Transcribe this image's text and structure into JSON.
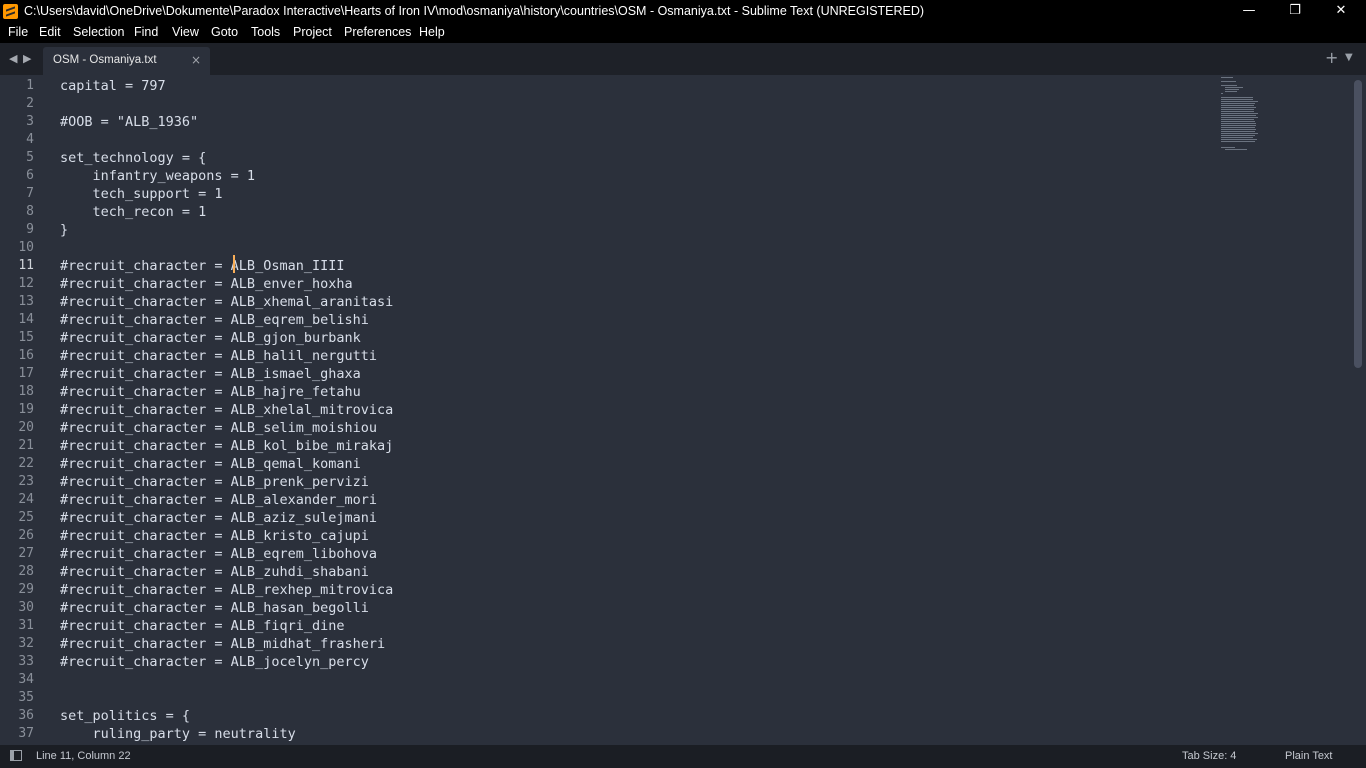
{
  "window": {
    "title": "C:\\Users\\david\\OneDrive\\Dokumente\\Paradox Interactive\\Hearts of Iron IV\\mod\\osmaniya\\history\\countries\\OSM - Osmaniya.txt - Sublime Text (UNREGISTERED)",
    "minimize_glyph": "—",
    "restore_glyph": "❐",
    "close_glyph": "✕"
  },
  "menu": [
    "File",
    "Edit",
    "Selection",
    "Find",
    "View",
    "Goto",
    "Tools",
    "Project",
    "Preferences",
    "Help"
  ],
  "tabs": {
    "active_label": "OSM - Osmaniya.txt",
    "close_glyph": "×",
    "back_glyph": "◀",
    "forward_glyph": "▶",
    "plus_glyph": "+",
    "menu_glyph": "▼"
  },
  "editor": {
    "active_line": 11,
    "lines": [
      {
        "n": "1",
        "text": "capital = 797"
      },
      {
        "n": "2",
        "text": ""
      },
      {
        "n": "3",
        "text": "#OOB = \"ALB_1936\""
      },
      {
        "n": "4",
        "text": ""
      },
      {
        "n": "5",
        "text": "set_technology = {"
      },
      {
        "n": "6",
        "text": "    infantry_weapons = 1"
      },
      {
        "n": "7",
        "text": "    tech_support = 1"
      },
      {
        "n": "8",
        "text": "    tech_recon = 1"
      },
      {
        "n": "9",
        "text": "}"
      },
      {
        "n": "10",
        "text": ""
      },
      {
        "n": "11",
        "text": "#recruit_character = ALB_Osman_IIII"
      },
      {
        "n": "12",
        "text": "#recruit_character = ALB_enver_hoxha"
      },
      {
        "n": "13",
        "text": "#recruit_character = ALB_xhemal_aranitasi"
      },
      {
        "n": "14",
        "text": "#recruit_character = ALB_eqrem_belishi"
      },
      {
        "n": "15",
        "text": "#recruit_character = ALB_gjon_burbank"
      },
      {
        "n": "16",
        "text": "#recruit_character = ALB_halil_nergutti"
      },
      {
        "n": "17",
        "text": "#recruit_character = ALB_ismael_ghaxa"
      },
      {
        "n": "18",
        "text": "#recruit_character = ALB_hajre_fetahu"
      },
      {
        "n": "19",
        "text": "#recruit_character = ALB_xhelal_mitrovica"
      },
      {
        "n": "20",
        "text": "#recruit_character = ALB_selim_moishiou"
      },
      {
        "n": "21",
        "text": "#recruit_character = ALB_kol_bibe_mirakaj"
      },
      {
        "n": "22",
        "text": "#recruit_character = ALB_qemal_komani"
      },
      {
        "n": "23",
        "text": "#recruit_character = ALB_prenk_pervizi"
      },
      {
        "n": "24",
        "text": "#recruit_character = ALB_alexander_mori"
      },
      {
        "n": "25",
        "text": "#recruit_character = ALB_aziz_sulejmani"
      },
      {
        "n": "26",
        "text": "#recruit_character = ALB_kristo_cajupi"
      },
      {
        "n": "27",
        "text": "#recruit_character = ALB_eqrem_libohova"
      },
      {
        "n": "28",
        "text": "#recruit_character = ALB_zuhdi_shabani"
      },
      {
        "n": "29",
        "text": "#recruit_character = ALB_rexhep_mitrovica"
      },
      {
        "n": "30",
        "text": "#recruit_character = ALB_hasan_begolli"
      },
      {
        "n": "31",
        "text": "#recruit_character = ALB_fiqri_dine"
      },
      {
        "n": "32",
        "text": "#recruit_character = ALB_midhat_frasheri"
      },
      {
        "n": "33",
        "text": "#recruit_character = ALB_jocelyn_percy"
      },
      {
        "n": "34",
        "text": ""
      },
      {
        "n": "35",
        "text": ""
      },
      {
        "n": "36",
        "text": "set_politics = {"
      },
      {
        "n": "37",
        "text": "    ruling_party = neutrality"
      }
    ]
  },
  "status": {
    "position": "Line 11, Column 22",
    "tab_size": "Tab Size: 4",
    "syntax": "Plain Text"
  },
  "colors": {
    "background": "#2b303b",
    "text": "#d8dee9",
    "caret": "#f9ae58",
    "titlebar": "#000000",
    "accent_icon": "#ff9800"
  }
}
